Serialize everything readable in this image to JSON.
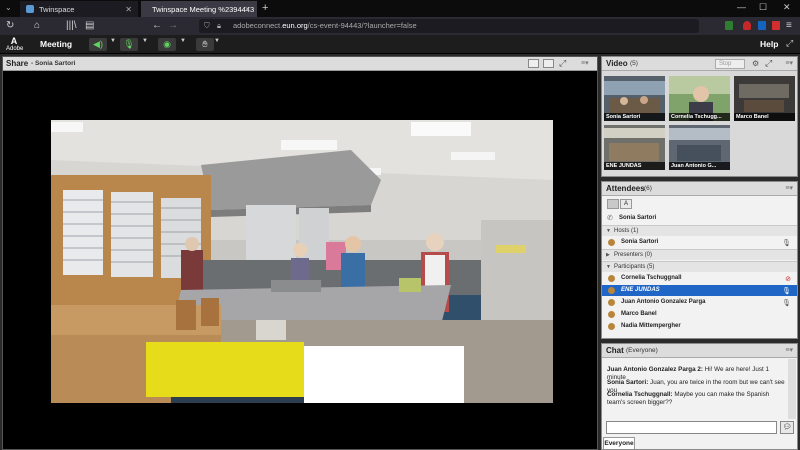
{
  "browser": {
    "tabs": [
      {
        "title": "Twinspace",
        "active": false
      },
      {
        "title": "Twinspace Meeting %2394443",
        "active": true
      }
    ],
    "url_prefix": "adobeconnect.",
    "url_domain": "eun.org",
    "url_suffix": "/cs-event-94443/?launcher=false",
    "colors": {
      "tabstrip": "#0c0c0d",
      "navbar": "#2b2a33",
      "accent": "#00c853"
    }
  },
  "connect_menu": {
    "logo_text": "Adobe",
    "meeting_label": "Meeting",
    "help_label": "Help"
  },
  "share_pod": {
    "title": "Share",
    "presenter": "- Sonia Sartori"
  },
  "video_pod": {
    "title": "Video",
    "count": "(5)",
    "stop_label": "Stop",
    "thumbnails": [
      {
        "name": "Sonia Sartori"
      },
      {
        "name": "Cornelia Tschugg..."
      },
      {
        "name": "Marco Banel"
      },
      {
        "name": "ENE JUNDAS"
      },
      {
        "name": "Juan Antonio G..."
      }
    ]
  },
  "attendees_pod": {
    "title": "Attendees",
    "count": "(6)",
    "me": "Sonia Sartori",
    "hosts_label": "Hosts (1)",
    "hosts": [
      "Sonia Sartori"
    ],
    "presenters_label": "Presenters (0)",
    "participants_label": "Participants (5)",
    "participants": [
      "Cornelia Tschuggnall",
      "ENE JUNDAS",
      "Juan Antonio Gonzalez Parga",
      "Marco Banel",
      "Nadia Mittempergher"
    ],
    "selected_index": 1
  },
  "chat_pod": {
    "title": "Chat",
    "audience": "(Everyone)",
    "messages": [
      {
        "sender": "Juan Antonio Gonzalez Parga 2:",
        "text": " Hi! We are here! Just 1 minute"
      },
      {
        "sender": "Sonia Sartori:",
        "text": " Juan, you are twice in the room but we can't see you"
      },
      {
        "sender": "Cornelia Tschuggnall:",
        "text": " Maybe you can make the Spanish team's screen bigger??"
      }
    ],
    "tab_label": "Everyone"
  }
}
